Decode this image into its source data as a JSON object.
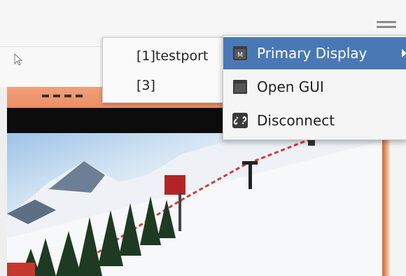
{
  "submenu": {
    "items": [
      {
        "label": "[1]testport"
      },
      {
        "label": "[3]"
      }
    ]
  },
  "context_menu": {
    "items": [
      {
        "label": "Primary Display",
        "icon": "monitor-icon"
      },
      {
        "label": "Open GUI",
        "icon": "window-icon"
      },
      {
        "label": "Disconnect",
        "icon": "broken-link-icon"
      }
    ]
  },
  "colors": {
    "menu_highlight": "#4a78b5",
    "accent_strip": "#ec8e63"
  }
}
